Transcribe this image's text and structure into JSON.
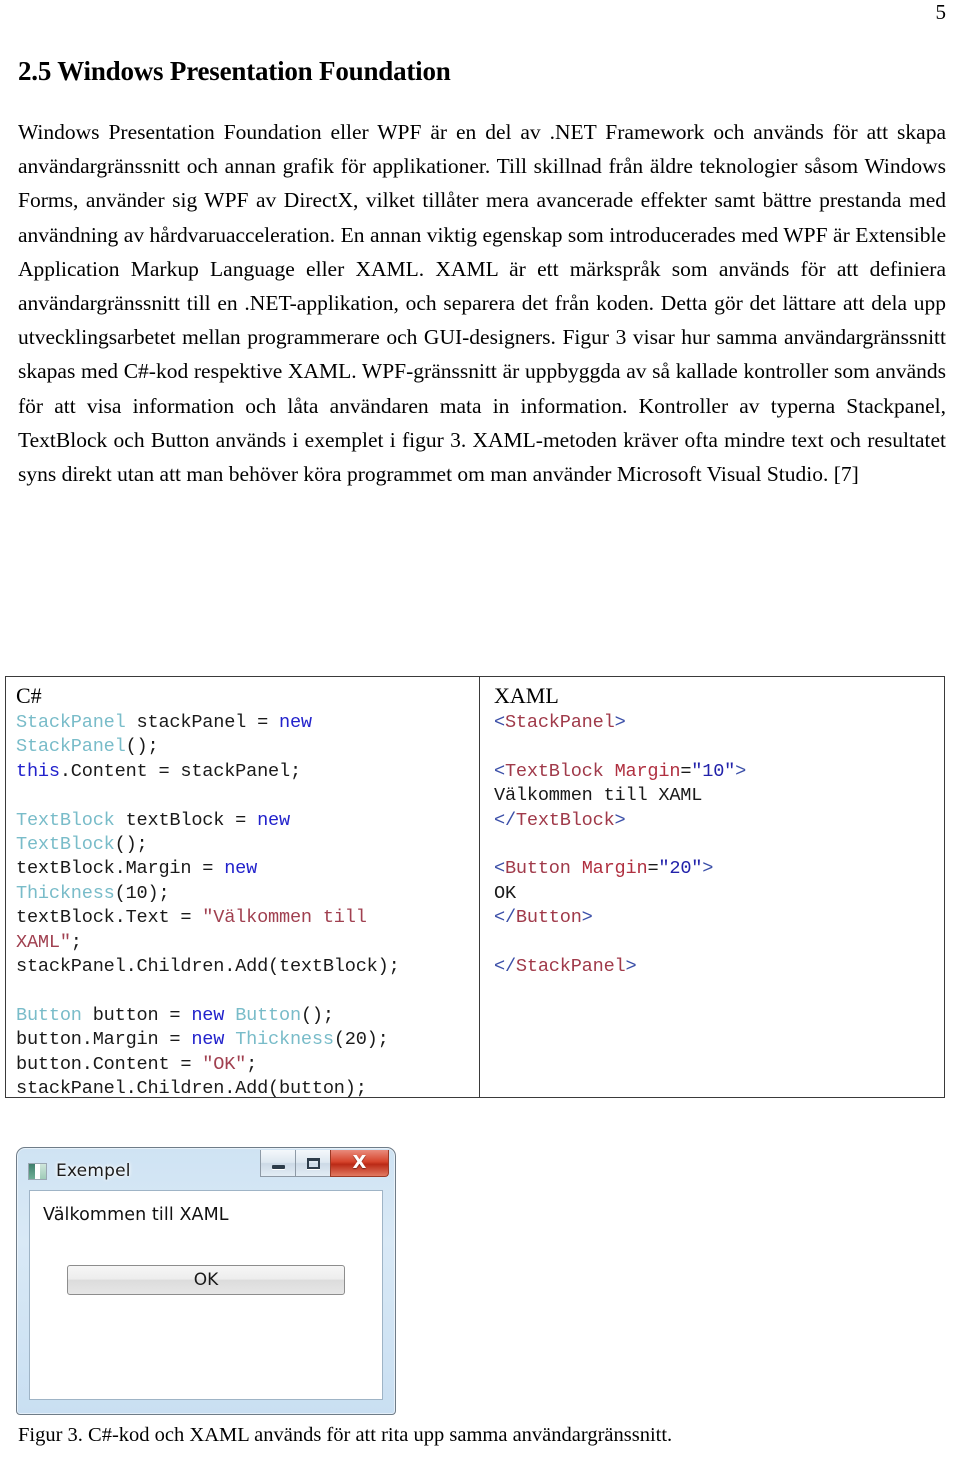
{
  "page": {
    "number": "5"
  },
  "heading": "2.5 Windows Presentation Foundation",
  "paragraph": "Windows Presentation Foundation eller WPF är en del av .NET Framework och används för att skapa användargränssnitt och annan grafik för applikationer. Till skillnad från äldre teknologier såsom Windows Forms, använder sig WPF av DirectX, vilket tillåter mera avancerade effekter samt bättre prestanda med användning av hårdvaruacceleration. En annan viktig egenskap som introducerades med WPF är Extensible Application Markup Language eller XAML. XAML är ett märkspråk som används för att definiera användargränssnitt till en .NET-applikation, och separera det från koden. Detta gör det lättare att dela upp utvecklingsarbetet mellan programmerare och GUI-designers. Figur 3 visar hur samma användargränssnitt skapas med C#-kod respektive XAML. WPF-gränssnitt är uppbyggda av så kallade kontroller som används för att visa information och låta användaren mata in information. Kontroller av typerna Stackpanel, TextBlock och Button används i exemplet i figur 3. XAML-metoden kräver ofta mindre text och resultatet syns direkt utan att man behöver köra programmet om man använder Microsoft Visual Studio. [7]",
  "code_table": {
    "csharp": {
      "lang_label": "C#",
      "code": "StackPanel stackPanel = new\nStackPanel();\nthis.Content = stackPanel;\n\nTextBlock textBlock = new\nTextBlock();\ntextBlock.Margin = new\nThickness(10);\ntextBlock.Text = \"Välkommen till\nXAML\";\nstackPanel.Children.Add(textBlock);\n\nButton button = new Button();\nbutton.Margin = new Thickness(20);\nbutton.Content = \"OK\";\nstackPanel.Children.Add(button);"
    },
    "xaml": {
      "lang_label": "XAML",
      "code": "<StackPanel>\n\n<TextBlock Margin=\"10\">\nVälkommen till XAML\n</TextBlock>\n\n<Button Margin=\"20\">\nOK\n</Button>\n\n</StackPanel>"
    }
  },
  "window_screenshot": {
    "title": "Exempel",
    "icon": "app-icon",
    "minimize_label": "Minimize",
    "maximize_label": "Maximize",
    "close_label": "X",
    "content_text": "Välkommen till XAML",
    "ok_button_label": "OK",
    "accent_close_color": "#d6442c",
    "frame_color": "#cfe3f3"
  },
  "figure_caption": "Figur 3. C#-kod och XAML används för att rita upp samma användargränssnitt.",
  "syntax_colors": {
    "type": "#79bcc9",
    "keyword": "#2222cc",
    "string": "#a04050",
    "xml_tag": "#a03a4a",
    "xml_bracket": "#3b4fa8",
    "xml_attr": "#b03040",
    "xml_value": "#2222aa"
  }
}
